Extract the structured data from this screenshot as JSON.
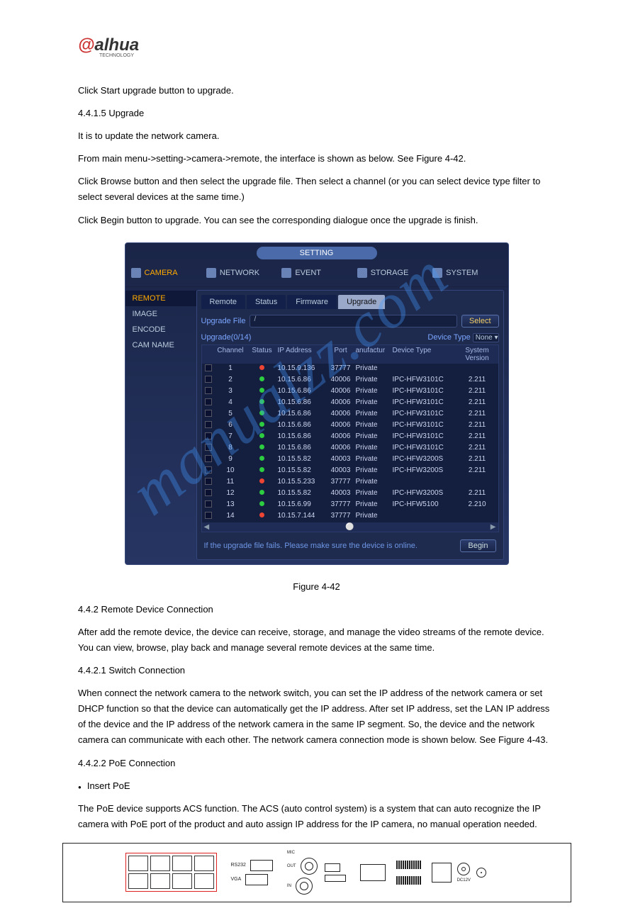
{
  "logo": {
    "brand": "alhua",
    "sub": "TECHNOLOGY"
  },
  "p1": "Click Start upgrade button to upgrade.",
  "h1": "4.4.1.5 Upgrade",
  "p2": "It is to update the network camera.",
  "p3": "From main menu->setting->camera->remote, the interface is shown as below. See Figure 4-42.",
  "p4": "Click Browse button and then select the upgrade file. Then select a channel (or you can select device type filter to select several devices at the same time.)",
  "p5": "Click Begin button to upgrade. You can see the corresponding dialogue once the upgrade is finish.",
  "figcap1": "Figure 4-42",
  "h2": "4.4.2 Remote Device Connection",
  "p6": "After add the remote device, the device can receive, storage, and manage the video streams of the remote device. You can view, browse, play back and manage several remote devices at the same time.",
  "h3": "4.4.2.1 Switch Connection",
  "p7": "When connect the network camera to the network switch, you can set the IP address of the network camera or set DHCP function so that the device can automatically get the IP address. After set IP address, set the LAN IP address of the device and the IP address of the network camera in the same IP segment. So, the device and the network camera can communicate with each other. The network camera connection mode is shown below. See Figure 4-43.",
  "h4": "4.4.2.2 PoE Connection",
  "b1": "Insert PoE",
  "p8": "The PoE device supports ACS function. The ACS (auto control system) is a system that can auto recognize the IP camera with PoE port of the product and auto assign IP address for the IP camera, no manual operation needed.",
  "ui": {
    "title": "SETTING",
    "nav": [
      "CAMERA",
      "NETWORK",
      "EVENT",
      "STORAGE",
      "SYSTEM"
    ],
    "side": [
      "REMOTE",
      "IMAGE",
      "ENCODE",
      "CAM NAME"
    ],
    "tabs": [
      "Remote",
      "Status",
      "Firmware",
      "Upgrade"
    ],
    "uflbl": "Upgrade File",
    "ufval": "/",
    "selbtn": "Select",
    "uplbl": "Upgrade(0/14)",
    "dtlbl": "Device Type",
    "dtval": "None",
    "cols": [
      "Channel",
      "Status",
      "IP Address",
      "Port",
      "anufactur",
      "Device Type",
      "System Version"
    ],
    "rows": [
      {
        "ch": "1",
        "st": "r",
        "ip": "10.15.9.136",
        "pt": "37777",
        "mf": "Private",
        "dt": "",
        "sv": ""
      },
      {
        "ch": "2",
        "st": "g",
        "ip": "10.15.6.86",
        "pt": "40006",
        "mf": "Private",
        "dt": "IPC-HFW3101C",
        "sv": "2.211"
      },
      {
        "ch": "3",
        "st": "g",
        "ip": "10.15.6.86",
        "pt": "40006",
        "mf": "Private",
        "dt": "IPC-HFW3101C",
        "sv": "2.211"
      },
      {
        "ch": "4",
        "st": "g",
        "ip": "10.15.6.86",
        "pt": "40006",
        "mf": "Private",
        "dt": "IPC-HFW3101C",
        "sv": "2.211"
      },
      {
        "ch": "5",
        "st": "g",
        "ip": "10.15.6.86",
        "pt": "40006",
        "mf": "Private",
        "dt": "IPC-HFW3101C",
        "sv": "2.211"
      },
      {
        "ch": "6",
        "st": "g",
        "ip": "10.15.6.86",
        "pt": "40006",
        "mf": "Private",
        "dt": "IPC-HFW3101C",
        "sv": "2.211"
      },
      {
        "ch": "7",
        "st": "g",
        "ip": "10.15.6.86",
        "pt": "40006",
        "mf": "Private",
        "dt": "IPC-HFW3101C",
        "sv": "2.211"
      },
      {
        "ch": "8",
        "st": "g",
        "ip": "10.15.6.86",
        "pt": "40006",
        "mf": "Private",
        "dt": "IPC-HFW3101C",
        "sv": "2.211"
      },
      {
        "ch": "9",
        "st": "g",
        "ip": "10.15.5.82",
        "pt": "40003",
        "mf": "Private",
        "dt": "IPC-HFW3200S",
        "sv": "2.211"
      },
      {
        "ch": "10",
        "st": "g",
        "ip": "10.15.5.82",
        "pt": "40003",
        "mf": "Private",
        "dt": "IPC-HFW3200S",
        "sv": "2.211"
      },
      {
        "ch": "11",
        "st": "r",
        "ip": "10.15.5.233",
        "pt": "37777",
        "mf": "Private",
        "dt": "",
        "sv": ""
      },
      {
        "ch": "12",
        "st": "g",
        "ip": "10.15.5.82",
        "pt": "40003",
        "mf": "Private",
        "dt": "IPC-HFW3200S",
        "sv": "2.211"
      },
      {
        "ch": "13",
        "st": "g",
        "ip": "10.15.6.99",
        "pt": "37777",
        "mf": "Private",
        "dt": "IPC-HFW5100",
        "sv": "2.210"
      },
      {
        "ch": "14",
        "st": "r",
        "ip": "10.15.7.144",
        "pt": "37777",
        "mf": "Private",
        "dt": "",
        "sv": ""
      }
    ],
    "hint": "If the upgrade file fails. Please make sure the device is online.",
    "begin": "Begin"
  },
  "rear": {
    "rs": "RS232",
    "vga": "VGA",
    "mic": "MIC",
    "out": "OUT",
    "in": "IN",
    "dc": "DC12V"
  }
}
